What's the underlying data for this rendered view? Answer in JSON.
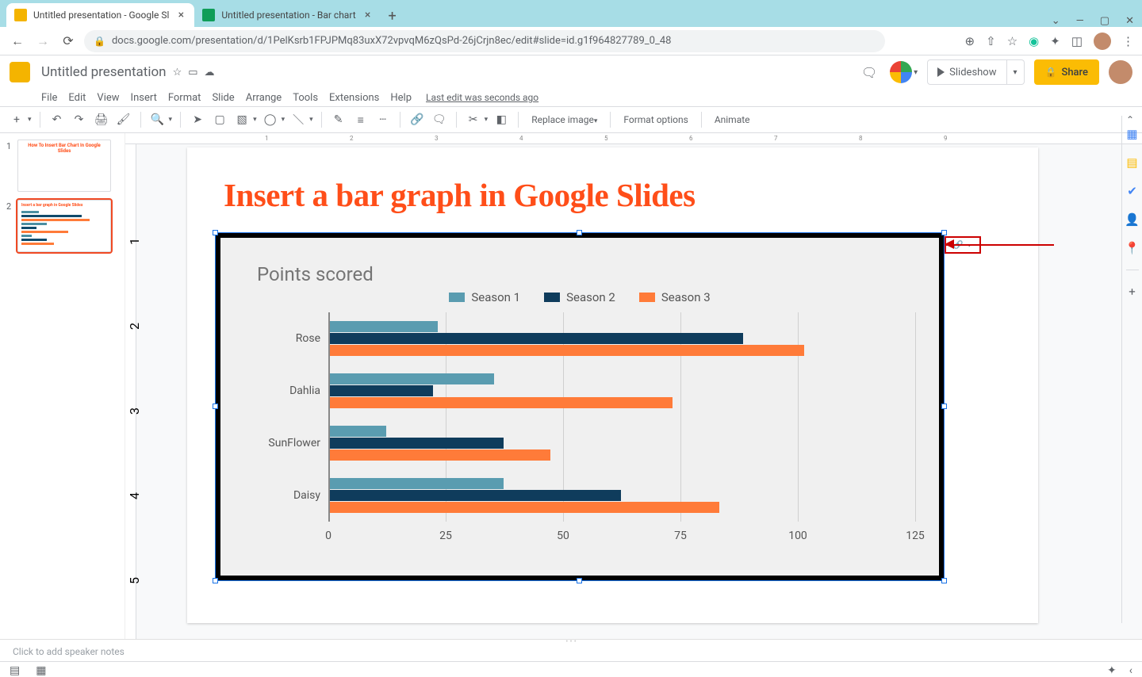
{
  "browser": {
    "tabs": [
      {
        "title": "Untitled presentation - Google Sl"
      },
      {
        "title": "Untitled presentation - Bar chart"
      }
    ],
    "url": "docs.google.com/presentation/d/1PelKsrb1FPJPMq83uxX72vpvqM6zQsPd-26jCrjn8ec/edit#slide=id.g1f964827789_0_48"
  },
  "app": {
    "doc_title": "Untitled presentation",
    "menus": [
      "File",
      "Edit",
      "View",
      "Insert",
      "Format",
      "Slide",
      "Arrange",
      "Tools",
      "Extensions",
      "Help"
    ],
    "last_edit": "Last edit was seconds ago",
    "slideshow_label": "Slideshow",
    "share_label": "Share",
    "toolbox": {
      "replace_image": "Replace image",
      "format_options": "Format options",
      "animate": "Animate"
    }
  },
  "filmstrip": {
    "slides": [
      {
        "num": "1",
        "title": "How To Insert Bar Chart In Google Slides"
      },
      {
        "num": "2",
        "title": "Insert a bar graph in Google Slides"
      }
    ]
  },
  "ruler_h": [
    "1",
    "2",
    "3",
    "4",
    "5",
    "6",
    "7",
    "8",
    "9"
  ],
  "ruler_v": [
    "1",
    "2",
    "3",
    "4",
    "5"
  ],
  "slide": {
    "title": "Insert a bar graph in Google Slides"
  },
  "chart_data": {
    "type": "bar",
    "title": "Points scored",
    "orientation": "horizontal",
    "categories": [
      "Rose",
      "Dahlia",
      "SunFlower",
      "Daisy"
    ],
    "series": [
      {
        "name": "Season 1",
        "color": "#5a9cb0",
        "values": [
          23,
          35,
          12,
          37
        ]
      },
      {
        "name": "Season 2",
        "color": "#0f3c5c",
        "values": [
          88,
          22,
          37,
          62
        ]
      },
      {
        "name": "Season 3",
        "color": "#ff7b39",
        "values": [
          101,
          73,
          47,
          83
        ]
      }
    ],
    "x_ticks": [
      0,
      25,
      50,
      75,
      100,
      125
    ],
    "x_range": [
      0,
      125
    ]
  },
  "notes_placeholder": "Click to add speaker notes"
}
